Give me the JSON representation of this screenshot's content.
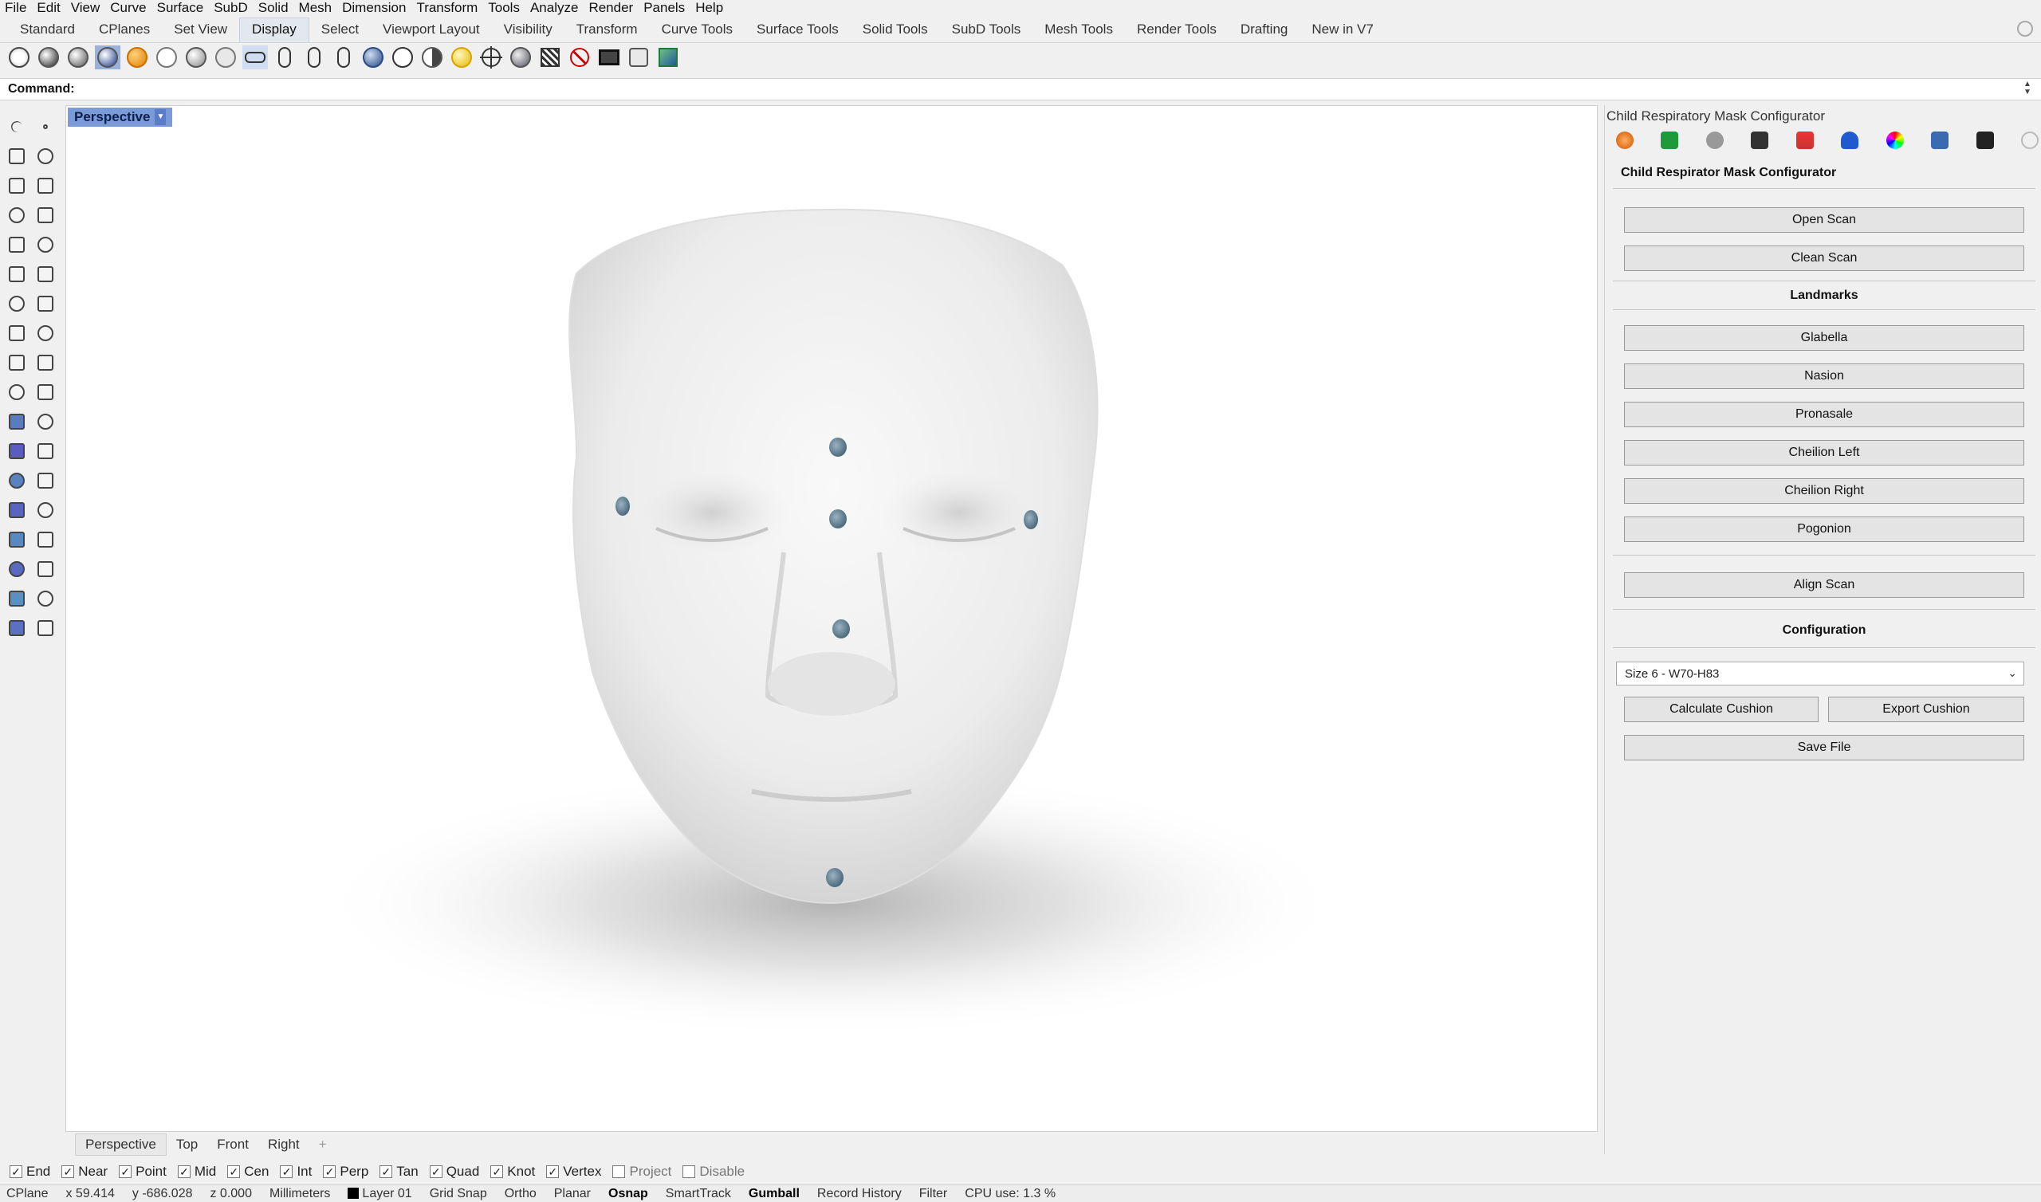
{
  "menu": [
    "File",
    "Edit",
    "View",
    "Curve",
    "Surface",
    "SubD",
    "Solid",
    "Mesh",
    "Dimension",
    "Transform",
    "Tools",
    "Analyze",
    "Render",
    "Panels",
    "Help"
  ],
  "tabs": [
    "Standard",
    "CPlanes",
    "Set View",
    "Display",
    "Select",
    "Viewport Layout",
    "Visibility",
    "Transform",
    "Curve Tools",
    "Surface Tools",
    "Solid Tools",
    "SubD Tools",
    "Mesh Tools",
    "Render Tools",
    "Drafting",
    "New in V7"
  ],
  "active_tab": "Display",
  "command": {
    "label": "Command:",
    "value": ""
  },
  "viewport": {
    "title": "Perspective"
  },
  "viewport_tabs": [
    "Perspective",
    "Top",
    "Front",
    "Right"
  ],
  "osnaps": [
    {
      "label": "End",
      "checked": true
    },
    {
      "label": "Near",
      "checked": true
    },
    {
      "label": "Point",
      "checked": true
    },
    {
      "label": "Mid",
      "checked": true
    },
    {
      "label": "Cen",
      "checked": true
    },
    {
      "label": "Int",
      "checked": true
    },
    {
      "label": "Perp",
      "checked": true
    },
    {
      "label": "Tan",
      "checked": true
    },
    {
      "label": "Quad",
      "checked": true
    },
    {
      "label": "Knot",
      "checked": true
    },
    {
      "label": "Vertex",
      "checked": true
    },
    {
      "label": "Project",
      "checked": false
    },
    {
      "label": "Disable",
      "checked": false
    }
  ],
  "status": {
    "cplane": "CPlane",
    "x": "x 59.414",
    "y": "y -686.028",
    "z": "z 0.000",
    "units": "Millimeters",
    "layer": "Layer 01",
    "grid_snap": "Grid Snap",
    "ortho": "Ortho",
    "planar": "Planar",
    "osnap": "Osnap",
    "smarttrack": "SmartTrack",
    "gumball": "Gumball",
    "record_history": "Record History",
    "filter": "Filter",
    "cpu": "CPU use: 1.3 %"
  },
  "panel": {
    "title": "Child Respiratory Mask Configurator",
    "header": "Child Respirator Mask Configurator",
    "open_scan": "Open Scan",
    "clean_scan": "Clean Scan",
    "landmarks_title": "Landmarks",
    "landmarks": [
      "Glabella",
      "Nasion",
      "Pronasale",
      "Cheilion Left",
      "Cheilion Right",
      "Pogonion"
    ],
    "align_scan": "Align Scan",
    "configuration_title": "Configuration",
    "size_value": "Size 6 - W70-H83",
    "calculate_cushion": "Calculate Cushion",
    "export_cushion": "Export Cushion",
    "save_file": "Save File"
  },
  "colors": {
    "viewport_title_bg": "#7b9ad8",
    "landmark_marker": "#6a8799",
    "face_surface": "#eeeeee"
  }
}
